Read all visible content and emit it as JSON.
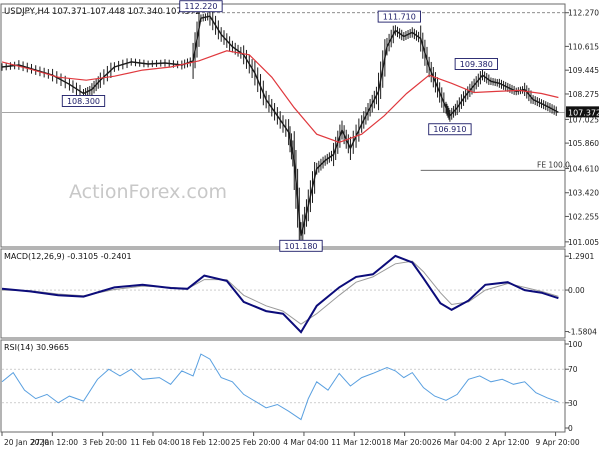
{
  "chart_data": {
    "type": "line",
    "title": "USDJPY,H4  107.371 107.448 107.340 107.372",
    "watermark": "ActionForex.com",
    "colors": {
      "price": "#1a1a1a",
      "ma": "#e0393e",
      "macd_main": "#0c0c7a",
      "macd_signal": "#9a9a9a",
      "rsi": "#5aa0e0",
      "label_border": "#1a1a66",
      "grid": "#b0b0b0",
      "current_price_box": "#111111"
    },
    "x_ticks": [
      "20 Jan 2020",
      "27 Jan 12:00",
      "3 Feb 20:00",
      "11 Feb 04:00",
      "18 Feb 12:00",
      "25 Feb 20:00",
      "4 Mar 04:00",
      "11 Mar 12:00",
      "18 Mar 20:00",
      "26 Mar 04:00",
      "2 Apr 12:00",
      "9 Apr 20:00"
    ],
    "price_panel": {
      "y_ticks": [
        "112.270",
        "110.615",
        "109.445",
        "108.275",
        "107.025",
        "105.860",
        "104.610",
        "103.420",
        "102.255",
        "101.005"
      ],
      "ylim": [
        100.9,
        112.6
      ],
      "hline": 112.27,
      "current_price": "107.372",
      "current_value": 107.372,
      "fe_label": "FE 100.0",
      "fe_level": 104.52,
      "annotations": [
        {
          "text": "112.220",
          "x": 0.354,
          "y": 112.22
        },
        {
          "text": "108.300",
          "x": 0.145,
          "y": 108.3
        },
        {
          "text": "111.710",
          "x": 0.707,
          "y": 111.71
        },
        {
          "text": "101.180",
          "x": 0.532,
          "y": 101.18
        },
        {
          "text": "109.380",
          "x": 0.844,
          "y": 109.38
        },
        {
          "text": "106.910",
          "x": 0.797,
          "y": 106.91
        }
      ],
      "price_series": [
        [
          0.0,
          109.6
        ],
        [
          0.03,
          109.7
        ],
        [
          0.06,
          109.45
        ],
        [
          0.09,
          109.2
        ],
        [
          0.12,
          108.75
        ],
        [
          0.145,
          108.3
        ],
        [
          0.16,
          108.5
        ],
        [
          0.175,
          108.95
        ],
        [
          0.2,
          109.6
        ],
        [
          0.23,
          109.85
        ],
        [
          0.26,
          109.75
        ],
        [
          0.29,
          109.8
        ],
        [
          0.32,
          109.7
        ],
        [
          0.34,
          109.9
        ],
        [
          0.354,
          112.0
        ],
        [
          0.37,
          112.1
        ],
        [
          0.39,
          111.2
        ],
        [
          0.41,
          110.6
        ],
        [
          0.43,
          110.2
        ],
        [
          0.45,
          109.3
        ],
        [
          0.47,
          108.0
        ],
        [
          0.49,
          107.2
        ],
        [
          0.51,
          106.4
        ],
        [
          0.52,
          105.0
        ],
        [
          0.532,
          101.3
        ],
        [
          0.545,
          102.8
        ],
        [
          0.56,
          104.6
        ],
        [
          0.575,
          105.0
        ],
        [
          0.59,
          105.3
        ],
        [
          0.605,
          106.5
        ],
        [
          0.62,
          105.6
        ],
        [
          0.64,
          106.8
        ],
        [
          0.655,
          107.6
        ],
        [
          0.67,
          108.4
        ],
        [
          0.685,
          110.6
        ],
        [
          0.7,
          111.4
        ],
        [
          0.715,
          111.1
        ],
        [
          0.73,
          111.3
        ],
        [
          0.745,
          111.0
        ],
        [
          0.76,
          109.6
        ],
        [
          0.775,
          108.6
        ],
        [
          0.79,
          107.6
        ],
        [
          0.797,
          107.2
        ],
        [
          0.81,
          107.6
        ],
        [
          0.825,
          108.2
        ],
        [
          0.84,
          108.7
        ],
        [
          0.855,
          109.2
        ],
        [
          0.87,
          108.9
        ],
        [
          0.885,
          108.8
        ],
        [
          0.9,
          108.6
        ],
        [
          0.915,
          108.4
        ],
        [
          0.93,
          108.5
        ],
        [
          0.945,
          108.0
        ],
        [
          0.96,
          107.8
        ],
        [
          0.975,
          107.6
        ],
        [
          0.99,
          107.37
        ]
      ],
      "ma_series": [
        [
          0.0,
          109.85
        ],
        [
          0.05,
          109.5
        ],
        [
          0.1,
          109.1
        ],
        [
          0.15,
          108.95
        ],
        [
          0.2,
          109.15
        ],
        [
          0.25,
          109.45
        ],
        [
          0.3,
          109.6
        ],
        [
          0.35,
          109.9
        ],
        [
          0.4,
          110.4
        ],
        [
          0.44,
          110.2
        ],
        [
          0.48,
          109.1
        ],
        [
          0.52,
          107.6
        ],
        [
          0.56,
          106.3
        ],
        [
          0.6,
          105.9
        ],
        [
          0.64,
          106.3
        ],
        [
          0.68,
          107.2
        ],
        [
          0.72,
          108.3
        ],
        [
          0.76,
          109.2
        ],
        [
          0.8,
          108.8
        ],
        [
          0.84,
          108.35
        ],
        [
          0.88,
          108.4
        ],
        [
          0.92,
          108.45
        ],
        [
          0.96,
          108.3
        ],
        [
          0.99,
          108.1
        ]
      ]
    },
    "macd_panel": {
      "label": "MACD(12,26,9) -0.3105 -0.2401",
      "y_ticks": [
        "1.2901",
        "0.00",
        "-1.5804"
      ],
      "ylim": [
        -1.75,
        1.45
      ],
      "main": [
        [
          0.0,
          0.05
        ],
        [
          0.05,
          -0.05
        ],
        [
          0.1,
          -0.2
        ],
        [
          0.145,
          -0.25
        ],
        [
          0.2,
          0.1
        ],
        [
          0.25,
          0.2
        ],
        [
          0.3,
          0.08
        ],
        [
          0.33,
          0.05
        ],
        [
          0.36,
          0.55
        ],
        [
          0.4,
          0.35
        ],
        [
          0.43,
          -0.45
        ],
        [
          0.47,
          -0.8
        ],
        [
          0.5,
          -0.9
        ],
        [
          0.532,
          -1.6
        ],
        [
          0.56,
          -0.6
        ],
        [
          0.6,
          0.1
        ],
        [
          0.63,
          0.5
        ],
        [
          0.66,
          0.6
        ],
        [
          0.7,
          1.3
        ],
        [
          0.73,
          1.05
        ],
        [
          0.75,
          0.45
        ],
        [
          0.78,
          -0.5
        ],
        [
          0.8,
          -0.75
        ],
        [
          0.83,
          -0.4
        ],
        [
          0.86,
          0.2
        ],
        [
          0.9,
          0.3
        ],
        [
          0.93,
          0.0
        ],
        [
          0.96,
          -0.1
        ],
        [
          0.99,
          -0.31
        ]
      ],
      "signal": [
        [
          0.0,
          0.0
        ],
        [
          0.05,
          -0.02
        ],
        [
          0.1,
          -0.15
        ],
        [
          0.145,
          -0.22
        ],
        [
          0.2,
          0.02
        ],
        [
          0.25,
          0.15
        ],
        [
          0.3,
          0.1
        ],
        [
          0.33,
          0.05
        ],
        [
          0.36,
          0.4
        ],
        [
          0.4,
          0.4
        ],
        [
          0.43,
          -0.2
        ],
        [
          0.47,
          -0.6
        ],
        [
          0.5,
          -0.8
        ],
        [
          0.532,
          -1.3
        ],
        [
          0.56,
          -0.9
        ],
        [
          0.6,
          -0.2
        ],
        [
          0.63,
          0.3
        ],
        [
          0.66,
          0.5
        ],
        [
          0.7,
          1.0
        ],
        [
          0.73,
          1.1
        ],
        [
          0.75,
          0.7
        ],
        [
          0.78,
          -0.1
        ],
        [
          0.8,
          -0.55
        ],
        [
          0.83,
          -0.45
        ],
        [
          0.86,
          0.0
        ],
        [
          0.9,
          0.25
        ],
        [
          0.93,
          0.1
        ],
        [
          0.96,
          -0.05
        ],
        [
          0.99,
          -0.24
        ]
      ]
    },
    "rsi_panel": {
      "label": "RSI(14) 30.9665",
      "y_ticks": [
        "100",
        "70",
        "30",
        "0"
      ],
      "ylim": [
        0,
        100
      ],
      "levels": [
        70,
        30
      ],
      "series": [
        [
          0.0,
          55
        ],
        [
          0.02,
          66
        ],
        [
          0.04,
          45
        ],
        [
          0.06,
          35
        ],
        [
          0.08,
          40
        ],
        [
          0.1,
          30
        ],
        [
          0.12,
          38
        ],
        [
          0.145,
          32
        ],
        [
          0.17,
          58
        ],
        [
          0.19,
          70
        ],
        [
          0.21,
          62
        ],
        [
          0.23,
          70
        ],
        [
          0.25,
          58
        ],
        [
          0.28,
          60
        ],
        [
          0.3,
          52
        ],
        [
          0.32,
          68
        ],
        [
          0.34,
          62
        ],
        [
          0.354,
          88
        ],
        [
          0.37,
          82
        ],
        [
          0.39,
          60
        ],
        [
          0.41,
          55
        ],
        [
          0.43,
          40
        ],
        [
          0.45,
          32
        ],
        [
          0.47,
          24
        ],
        [
          0.49,
          28
        ],
        [
          0.51,
          20
        ],
        [
          0.532,
          10
        ],
        [
          0.545,
          35
        ],
        [
          0.56,
          55
        ],
        [
          0.58,
          45
        ],
        [
          0.6,
          65
        ],
        [
          0.62,
          50
        ],
        [
          0.64,
          60
        ],
        [
          0.66,
          65
        ],
        [
          0.685,
          72
        ],
        [
          0.7,
          68
        ],
        [
          0.715,
          60
        ],
        [
          0.73,
          66
        ],
        [
          0.75,
          48
        ],
        [
          0.77,
          38
        ],
        [
          0.79,
          33
        ],
        [
          0.81,
          40
        ],
        [
          0.83,
          58
        ],
        [
          0.85,
          62
        ],
        [
          0.87,
          55
        ],
        [
          0.89,
          58
        ],
        [
          0.91,
          52
        ],
        [
          0.93,
          55
        ],
        [
          0.95,
          42
        ],
        [
          0.97,
          36
        ],
        [
          0.99,
          31
        ]
      ]
    }
  }
}
